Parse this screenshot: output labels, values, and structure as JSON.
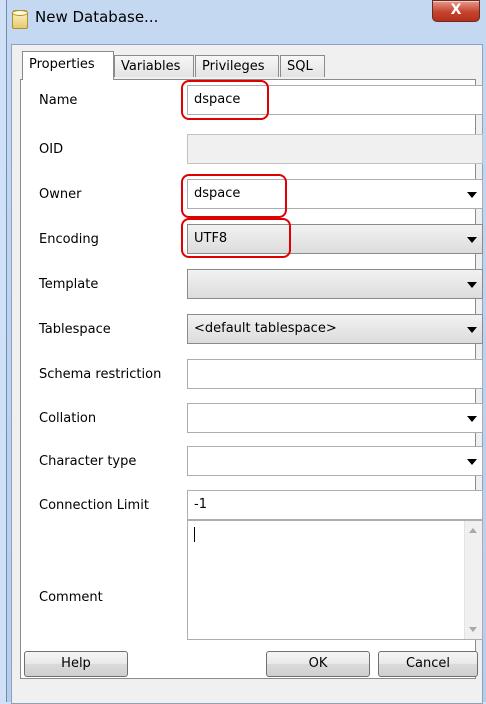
{
  "window": {
    "title": "New Database...",
    "close_glyph": "X"
  },
  "tabs": [
    {
      "label": "Properties",
      "active": true
    },
    {
      "label": "Variables",
      "active": false
    },
    {
      "label": "Privileges",
      "active": false
    },
    {
      "label": "SQL",
      "active": false
    }
  ],
  "fields": {
    "name": {
      "label": "Name",
      "value": "dspace"
    },
    "oid": {
      "label": "OID",
      "value": ""
    },
    "owner": {
      "label": "Owner",
      "value": "dspace"
    },
    "encoding": {
      "label": "Encoding",
      "value": "UTF8"
    },
    "template": {
      "label": "Template",
      "value": ""
    },
    "tablespace": {
      "label": "Tablespace",
      "value": "<default tablespace>"
    },
    "schema_restriction": {
      "label": "Schema restriction",
      "value": ""
    },
    "collation": {
      "label": "Collation",
      "value": ""
    },
    "character_type": {
      "label": "Character type",
      "value": ""
    },
    "connection_limit": {
      "label": "Connection Limit",
      "value": "-1"
    },
    "comment": {
      "label": "Comment",
      "value": ""
    }
  },
  "buttons": {
    "help": "Help",
    "ok": "OK",
    "cancel": "Cancel"
  },
  "colors": {
    "highlight": "#e00000",
    "titlebar": "#c4d8f1",
    "close": "#c5432f"
  },
  "icons": [
    "database-icon",
    "close-icon",
    "dropdown-arrow-icon",
    "scroll-up-icon",
    "scroll-down-icon"
  ]
}
